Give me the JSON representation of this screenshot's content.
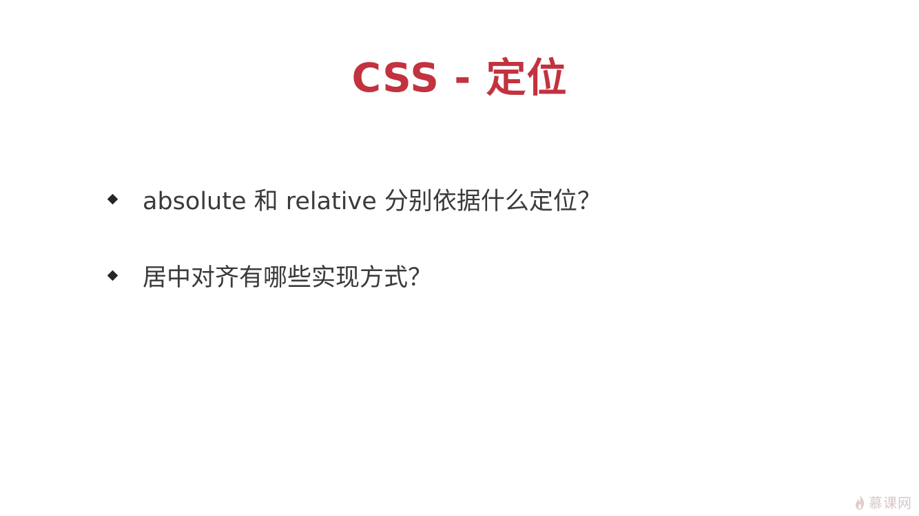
{
  "slide": {
    "title": "CSS - 定位",
    "bullets": [
      {
        "text": "absolute 和 relative 分别依据什么定位？"
      },
      {
        "text": "居中对齐有哪些实现方式？"
      }
    ]
  },
  "watermark": {
    "icon": "flame-logo-icon",
    "text": "慕课网"
  },
  "colors": {
    "title": "#c2323f",
    "body_text": "#3a3a3a",
    "bullet": "#262626",
    "background": "#ffffff"
  }
}
